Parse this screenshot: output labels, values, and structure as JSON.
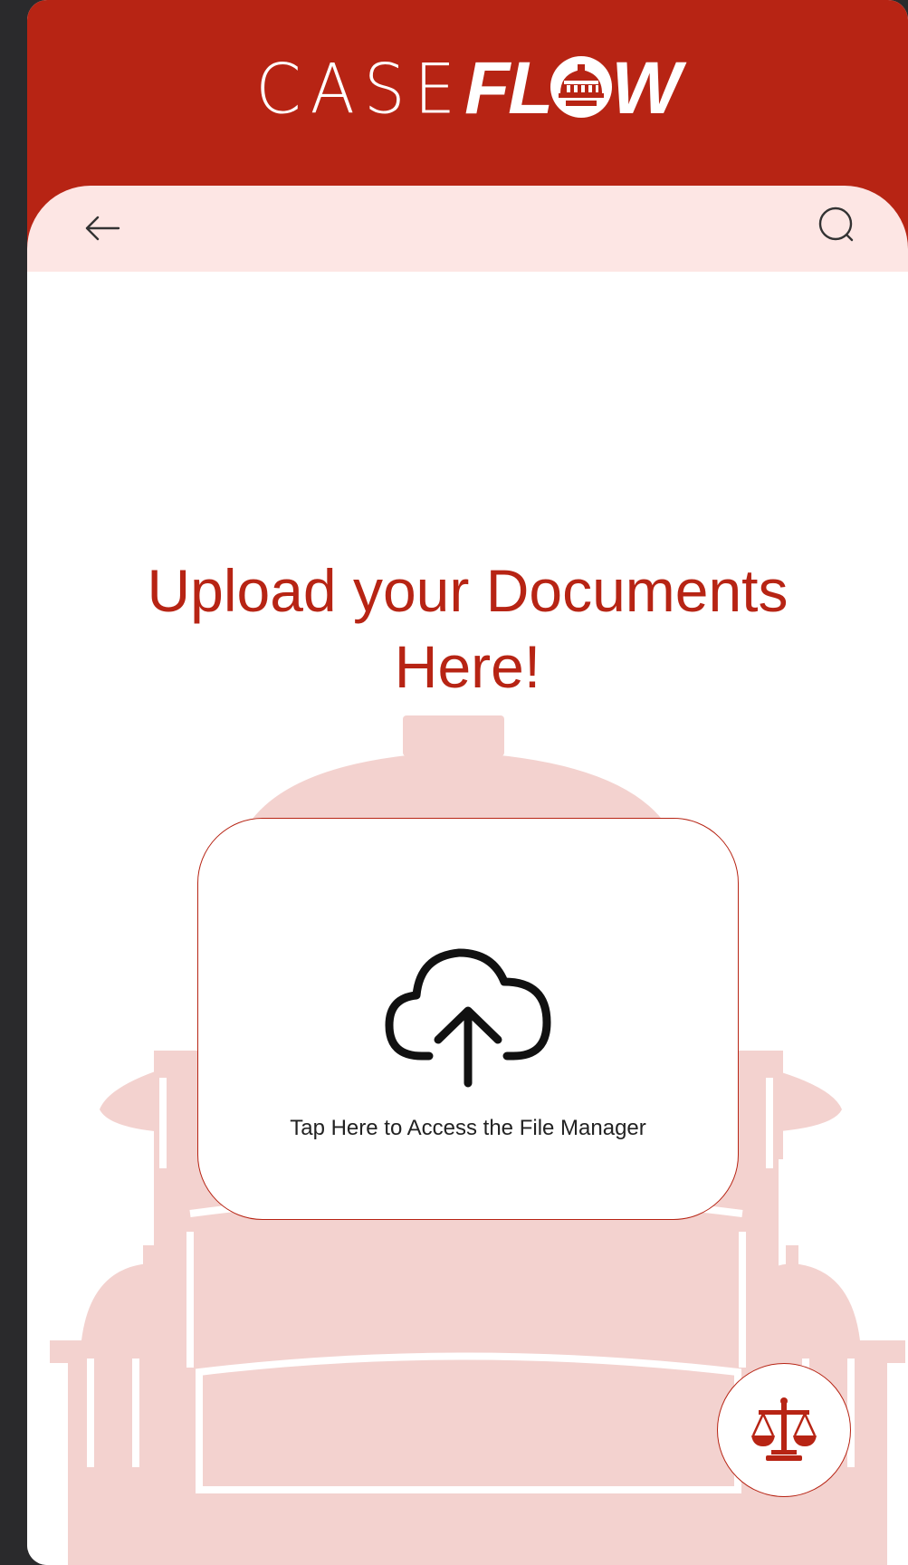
{
  "app": {
    "logo_text_left": "CASE",
    "logo_text_right": "FL",
    "logo_text_end": "W"
  },
  "nav": {
    "back_icon": "arrow-left-icon",
    "search_icon": "search-icon"
  },
  "main": {
    "title_line1": "Upload your Documents",
    "title_line2": "Here!",
    "upload_icon": "cloud-upload-icon",
    "upload_label": "Tap Here to Access the File Manager"
  },
  "fab": {
    "icon": "scales-of-justice-icon"
  },
  "colors": {
    "brand": "#b72414",
    "nav_bg": "#fde6e4",
    "illustration": "#f3d2cf",
    "frame": "#2a2a2c"
  }
}
